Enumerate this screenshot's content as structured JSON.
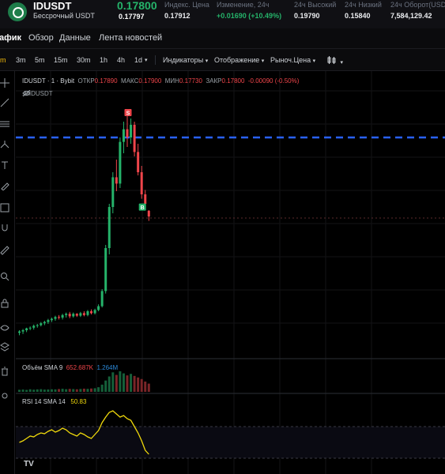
{
  "ticker": {
    "symbol": "IDUSDT",
    "subtitle": "Бессрочный USDT",
    "last_price": "0.17800",
    "mark_price": "0.17797",
    "stats": [
      {
        "label": "Индекс. Цена",
        "value": "0.17912",
        "tone": "normal"
      },
      {
        "label": "Изменение, 24ч",
        "value": "+0.01690 (+10.49%)",
        "tone": "green"
      },
      {
        "label": "24ч Высокий",
        "value": "0.19790",
        "tone": "normal"
      },
      {
        "label": "24ч Низкий",
        "value": "0.15840",
        "tone": "normal"
      },
      {
        "label": "24ч Оборот(USDT)",
        "value": "7,584,129.42",
        "tone": "normal"
      }
    ]
  },
  "tabs": [
    "афик",
    "Обзор",
    "Данные",
    "Лента новостей"
  ],
  "toolbar": {
    "intervals": [
      "m",
      "3m",
      "5m",
      "15m",
      "30m",
      "1h",
      "4h",
      "1d"
    ],
    "indicators": "Индикаторы",
    "display": "Отображение",
    "market_price": "Рыноч.Цена",
    "chart_type_icon": "candles-icon"
  },
  "chart_data": {
    "type": "candlestick",
    "symbol_line": "IDUSDT · 1 · Bybit",
    "ohlc_label": {
      "open_k": "ОТКР",
      "open": "0.17890",
      "high_k": "МАКС",
      "high": "0.17900",
      "low_k": "МИН",
      "low": "0.17730",
      "close_k": "ЗАКР",
      "close": "0.17800",
      "change": "-0.00090 (-0.50%)"
    },
    "mark_series_label": ".MIDUSDT",
    "candles": [
      [
        0.1596,
        0.16,
        0.1592,
        0.1598
      ],
      [
        0.1598,
        0.1602,
        0.1594,
        0.16
      ],
      [
        0.16,
        0.1604,
        0.1597,
        0.1603
      ],
      [
        0.1603,
        0.1606,
        0.16,
        0.1604
      ],
      [
        0.1604,
        0.1609,
        0.1601,
        0.1607
      ],
      [
        0.1607,
        0.161,
        0.1604,
        0.1608
      ],
      [
        0.1608,
        0.1613,
        0.1606,
        0.1611
      ],
      [
        0.1611,
        0.1615,
        0.1608,
        0.1613
      ],
      [
        0.1613,
        0.1618,
        0.161,
        0.1616
      ],
      [
        0.1616,
        0.162,
        0.1613,
        0.1618
      ],
      [
        0.1618,
        0.1623,
        0.1615,
        0.1621
      ],
      [
        0.1621,
        0.1624,
        0.1617,
        0.162
      ],
      [
        0.162,
        0.1626,
        0.1617,
        0.1624
      ],
      [
        0.1624,
        0.1628,
        0.162,
        0.1626
      ],
      [
        0.1626,
        0.1629,
        0.1619,
        0.1622
      ],
      [
        0.1622,
        0.1628,
        0.162,
        0.1626
      ],
      [
        0.1626,
        0.1627,
        0.1621,
        0.1623
      ],
      [
        0.1623,
        0.1629,
        0.1621,
        0.1627
      ],
      [
        0.1627,
        0.163,
        0.1622,
        0.1624
      ],
      [
        0.1624,
        0.1632,
        0.1622,
        0.163
      ],
      [
        0.163,
        0.1633,
        0.1625,
        0.1627
      ],
      [
        0.1627,
        0.1634,
        0.1625,
        0.1632
      ],
      [
        0.1632,
        0.1641,
        0.163,
        0.1638
      ],
      [
        0.1638,
        0.1665,
        0.1636,
        0.1662
      ],
      [
        0.1662,
        0.1735,
        0.1658,
        0.173
      ],
      [
        0.173,
        0.18,
        0.172,
        0.1795
      ],
      [
        0.1795,
        0.185,
        0.1785,
        0.1842
      ],
      [
        0.1842,
        0.187,
        0.182,
        0.1832
      ],
      [
        0.1832,
        0.1905,
        0.1825,
        0.1898
      ],
      [
        0.1898,
        0.193,
        0.188,
        0.1918
      ],
      [
        0.1918,
        0.194,
        0.189,
        0.1905
      ],
      [
        0.1905,
        0.1935,
        0.1895,
        0.1925
      ],
      [
        0.1925,
        0.193,
        0.1875,
        0.1882
      ],
      [
        0.1882,
        0.1895,
        0.1845,
        0.185
      ],
      [
        0.185,
        0.186,
        0.1808,
        0.1815
      ],
      [
        0.1815,
        0.1822,
        0.179,
        0.18
      ],
      [
        0.1789,
        0.179,
        0.1773,
        0.178
      ]
    ],
    "markers": [
      {
        "label": "S",
        "at_index": 30,
        "color": "#ef454a"
      },
      {
        "label": "B",
        "at_index": 34,
        "color": "#25b36a"
      }
    ],
    "price_line_color": "#2962ff",
    "volume": {
      "label": "Объём SMA 9",
      "value1": "652.687K",
      "value2": "1.264M",
      "values": [
        40,
        45,
        38,
        50,
        42,
        48,
        52,
        44,
        46,
        50,
        48,
        55,
        60,
        52,
        58,
        54,
        50,
        56,
        62,
        58,
        65,
        70,
        90,
        140,
        220,
        300,
        380,
        330,
        400,
        360,
        320,
        350,
        310,
        280,
        250,
        200,
        160
      ]
    },
    "rsi": {
      "label": "RSI 14 SMA 14",
      "value": "50.83",
      "values": [
        50,
        52,
        55,
        58,
        57,
        60,
        62,
        61,
        64,
        66,
        63,
        65,
        68,
        66,
        62,
        60,
        58,
        62,
        60,
        57,
        55,
        60,
        65,
        75,
        82,
        88,
        90,
        86,
        82,
        84,
        80,
        78,
        70,
        62,
        52,
        40,
        35
      ],
      "levels": [
        70,
        30
      ],
      "ylim": [
        20,
        100
      ]
    },
    "ylim": [
      0.156,
      0.196
    ]
  },
  "colors": {
    "up": "#25b36a",
    "down": "#ef454a",
    "rsi": "#f0d90b",
    "accent": "#f0b90b"
  }
}
